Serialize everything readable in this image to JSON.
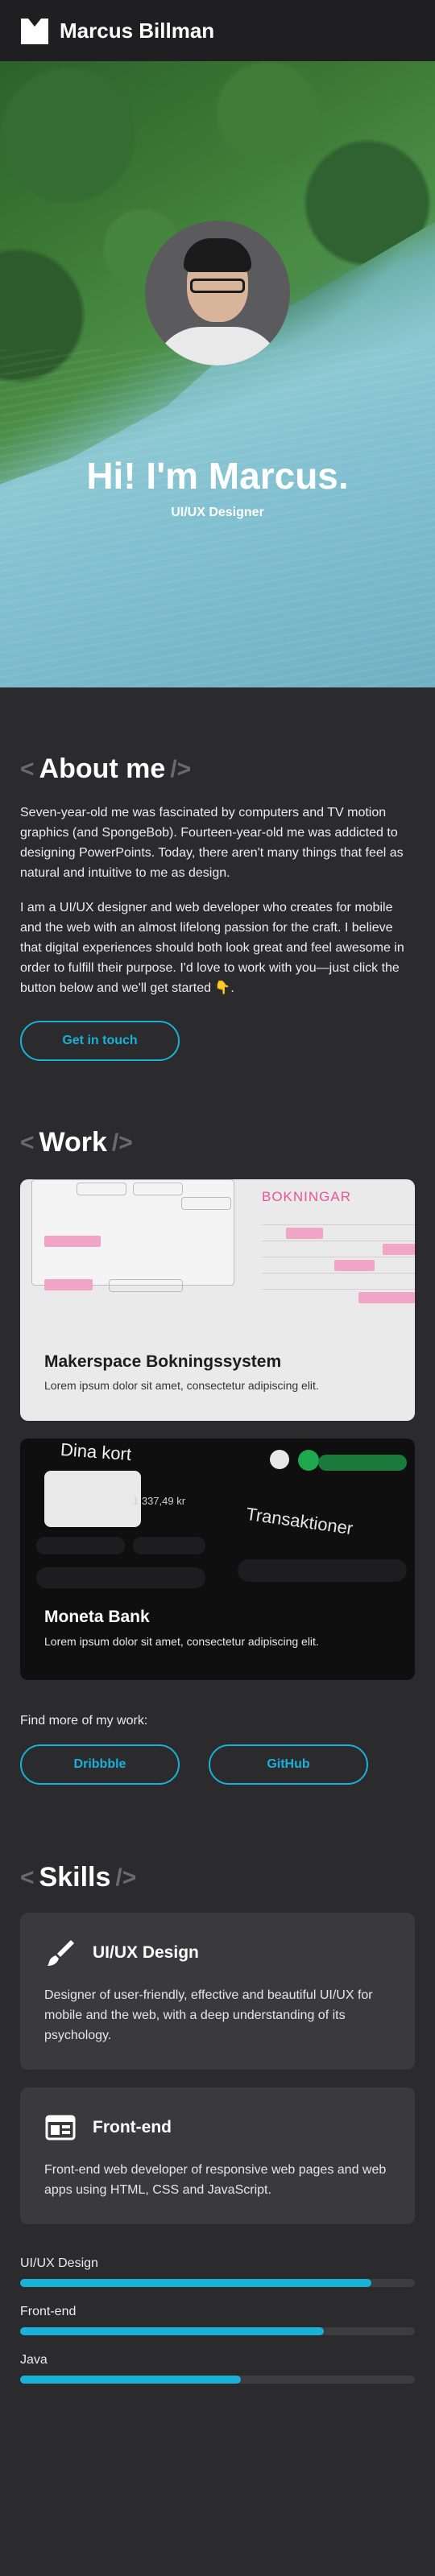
{
  "header": {
    "site_name": "Marcus Billman",
    "logo_icon": "m-logo-icon"
  },
  "hero": {
    "title": "Hi! I'm Marcus.",
    "subtitle": "UI/UX Designer"
  },
  "about": {
    "title": "About me",
    "bracket_left": "<",
    "bracket_right": "/>",
    "para1": "Seven-year-old me was fascinated by computers and TV motion graphics (and SpongeBob). Fourteen-year-old me was addicted to designing PowerPoints. Today, there aren't many things that feel as natural and intuitive to me as design.",
    "para2": "I am a UI/UX designer and web developer who creates for mobile and the web with an almost lifelong passion for the craft. I believe that digital experiences should both look great and feel awesome in order to fulfill their purpose. I'd love to work with you—just click the button below and we'll get started 👇.",
    "button": "Get in touch"
  },
  "work": {
    "title": "Work",
    "bracket_left": "<",
    "bracket_right": "/>",
    "projects": [
      {
        "title": "Makerspace Bokningssystem",
        "desc": "Lorem ipsum dolor sit amet, consectetur adipiscing elit.",
        "shot_heading": "BOKNINGAR"
      },
      {
        "title": "Moneta Bank",
        "desc": "Lorem ipsum dolor sit amet, consectetur adipiscing elit.",
        "shot_heading_left": "Dina kort",
        "shot_heading_right": "Transaktioner",
        "shot_amount": "1 337,49 kr"
      }
    ],
    "find_more": "Find more of my work:",
    "links": [
      "Dribbble",
      "GitHub"
    ]
  },
  "skills": {
    "title": "Skills",
    "bracket_left": "<",
    "bracket_right": "/>",
    "cards": [
      {
        "name": "UI/UX Design",
        "icon": "brush-icon",
        "desc": "Designer of user-friendly, effective and beautiful UI/UX for mobile and the web, with a deep understanding of its psychology."
      },
      {
        "name": "Front-end",
        "icon": "browser-window-icon",
        "desc": "Front-end web developer of responsive web pages and web apps using HTML, CSS and JavaScript."
      }
    ],
    "bars": [
      {
        "label": "UI/UX Design",
        "level": 0.89
      },
      {
        "label": "Front-end",
        "level": 0.77
      },
      {
        "label": "Java",
        "level": 0.56
      }
    ]
  },
  "colors": {
    "accent": "#1ab1d8",
    "background": "#2b2b2d",
    "header": "#1f1f21",
    "card": "#3a3a3d"
  }
}
